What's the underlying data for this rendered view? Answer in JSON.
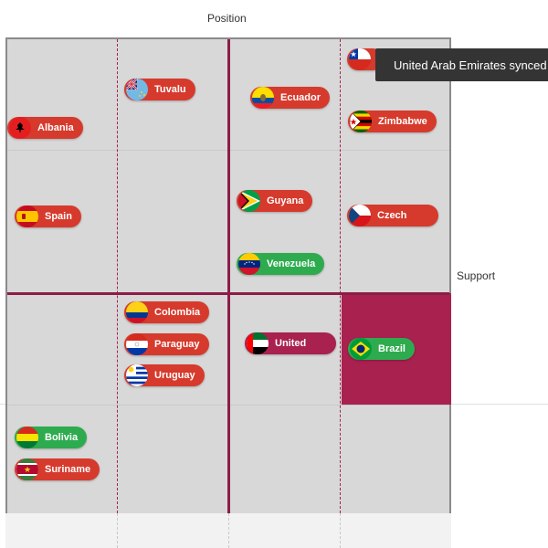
{
  "axes": {
    "position_label": "Position",
    "support_label": "Support"
  },
  "tooltip": {
    "text": "United Arab Emirates synced"
  },
  "chips": [
    {
      "id": "chile",
      "label": "",
      "flag": "chile-flag-icon",
      "color": "green"
    },
    {
      "id": "tuvalu",
      "label": "Tuvalu",
      "flag": "tuvalu-flag-icon",
      "color": "red"
    },
    {
      "id": "ecuador",
      "label": "Ecuador",
      "flag": "ecuador-flag-icon",
      "color": "red"
    },
    {
      "id": "albania",
      "label": "Albania",
      "flag": "albania-flag-icon",
      "color": "red"
    },
    {
      "id": "zimbabwe",
      "label": "Zimbabwe",
      "flag": "zimbabwe-flag-icon",
      "color": "red"
    },
    {
      "id": "spain",
      "label": "Spain",
      "flag": "spain-flag-icon",
      "color": "red"
    },
    {
      "id": "guyana",
      "label": "Guyana",
      "flag": "guyana-flag-icon",
      "color": "red"
    },
    {
      "id": "czech",
      "label": "Czech",
      "flag": "czech-flag-icon",
      "color": "red"
    },
    {
      "id": "venezuela",
      "label": "Venezuela",
      "flag": "venezuela-flag-icon",
      "color": "green"
    },
    {
      "id": "colombia",
      "label": "Colombia",
      "flag": "colombia-flag-icon",
      "color": "red"
    },
    {
      "id": "paraguay",
      "label": "Paraguay",
      "flag": "paraguay-flag-icon",
      "color": "red"
    },
    {
      "id": "uruguay",
      "label": "Uruguay",
      "flag": "uruguay-flag-icon",
      "color": "red"
    },
    {
      "id": "united",
      "label": "United",
      "flag": "uae-flag-icon",
      "color": "maroon"
    },
    {
      "id": "brazil",
      "label": "Brazil",
      "flag": "brazil-flag-icon",
      "color": "green"
    },
    {
      "id": "bolivia",
      "label": "Bolivia",
      "flag": "bolivia-flag-icon",
      "color": "green"
    },
    {
      "id": "suriname",
      "label": "Suriname",
      "flag": "suriname-flag-icon",
      "color": "red"
    }
  ],
  "colors": {
    "red": "#d63a2c",
    "green": "#2eab4e",
    "maroon": "#a8214f",
    "board": "#d8d8d8"
  }
}
